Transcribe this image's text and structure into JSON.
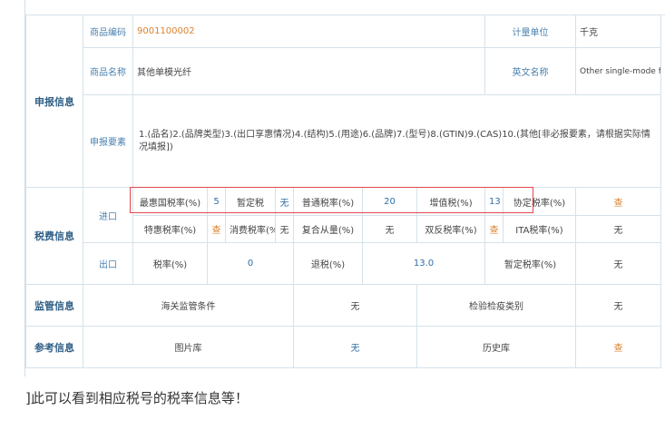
{
  "declare": {
    "section": "申报信息",
    "code_label": "商品编码",
    "code_value": "9001100002",
    "unit_label": "计量单位",
    "unit_value": "千克",
    "name_label": "商品名称",
    "name_value": "其他单模光纤",
    "en_label": "英文名称",
    "en_value": "Other single-mode fibers",
    "elements_label": "申报要素",
    "elements_value": "1.(品名)2.(品牌类型)3.(出口享惠情况)4.(结构)5.(用途)6.(品牌)7.(型号)8.(GTIN)9.(CAS)10.(其他[非必报要素，请根据实际情况填报])"
  },
  "tax": {
    "section": "税费信息",
    "import_label": "进口",
    "export_label": "出口",
    "row1": [
      {
        "label": "最惠国税率(%)",
        "value": "5"
      },
      {
        "label": "暂定税",
        "value": "无"
      },
      {
        "label": "普通税率(%)",
        "value": "20"
      },
      {
        "label": "增值税(%)",
        "value": "13"
      },
      {
        "label": "协定税率(%)",
        "value": "查"
      }
    ],
    "row2": [
      {
        "label": "特惠税率(%)",
        "value": "查"
      },
      {
        "label": "消费税率(%)",
        "value": "无"
      },
      {
        "label": "复合从量(%)",
        "value": "无"
      },
      {
        "label": "双反税率(%)",
        "value": "查"
      },
      {
        "label": "ITA税率(%)",
        "value": "无"
      }
    ],
    "export_row": [
      {
        "label": "税率(%)",
        "value": "0"
      },
      {
        "label": "退税(%)",
        "value": "13.0"
      },
      {
        "label": "暂定税率(%)",
        "value": "无"
      }
    ]
  },
  "supervision": {
    "section": "监管信息",
    "customs_label": "海关监管条件",
    "customs_value": "无",
    "inspection_label": "检验检疫类别",
    "inspection_value": "无"
  },
  "reference": {
    "section": "参考信息",
    "image_label": "图片库",
    "image_value": "无",
    "history_label": "历史库",
    "history_value": "查"
  },
  "caption": "]此可以看到相应税号的税率信息等！"
}
